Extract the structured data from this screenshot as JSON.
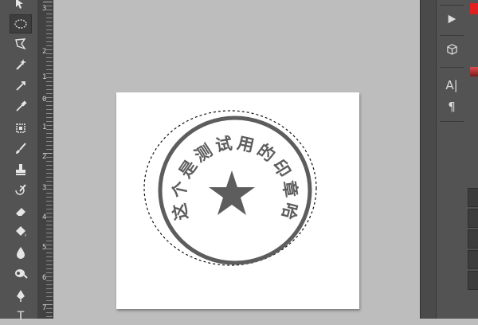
{
  "tools": [
    {
      "id": "move",
      "icon": "move-tool-icon"
    },
    {
      "id": "elliptical-marquee",
      "icon": "elliptical-marquee-icon",
      "selected": true
    },
    {
      "id": "lasso",
      "icon": "polygonal-lasso-icon"
    },
    {
      "id": "magic-wand",
      "icon": "magic-wand-icon"
    },
    {
      "id": "crop",
      "icon": "crop-tool-icon"
    },
    {
      "id": "eyedropper",
      "icon": "eyedropper-icon"
    },
    {
      "id": "healing",
      "icon": "spot-healing-brush-icon"
    },
    {
      "id": "brush",
      "icon": "brush-icon"
    },
    {
      "id": "stamp",
      "icon": "clone-stamp-icon"
    },
    {
      "id": "history-brush",
      "icon": "history-brush-icon"
    },
    {
      "id": "eraser",
      "icon": "eraser-icon"
    },
    {
      "id": "paint-bucket",
      "icon": "paint-bucket-icon"
    },
    {
      "id": "blur",
      "icon": "blur-tool-icon"
    },
    {
      "id": "dodge",
      "icon": "dodge-tool-icon"
    },
    {
      "id": "pen",
      "icon": "pen-tool-icon"
    },
    {
      "id": "type",
      "icon": "type-tool-icon",
      "label": "T"
    }
  ],
  "ruler": {
    "labels": [
      "3",
      "2",
      "1",
      "0",
      "1",
      "2",
      "3",
      "4",
      "5",
      "6",
      "7"
    ]
  },
  "stamp": {
    "arc_text": "这个是测试用的印章哈",
    "center_icon": "star-icon",
    "ink_color": "#5d5d5d"
  },
  "right_icons": [
    {
      "id": "play",
      "icon": "play-icon"
    },
    {
      "id": "3d",
      "icon": "3d-cube-icon"
    },
    {
      "id": "character",
      "icon": "character-panel-icon",
      "label": "A|"
    },
    {
      "id": "paragraph",
      "icon": "paragraph-panel-icon",
      "label": "¶"
    }
  ],
  "colors": {
    "panel_bg": "#535353",
    "workspace_bg": "#bdbdbd",
    "foreground_swatch": "#e02020"
  }
}
